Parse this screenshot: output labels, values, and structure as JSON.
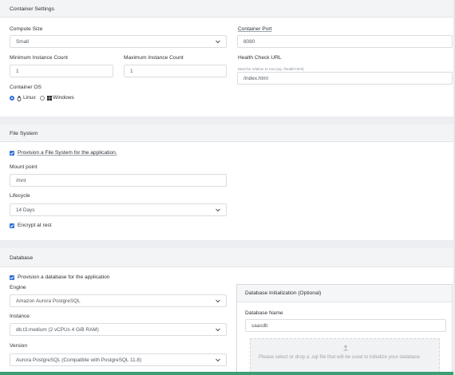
{
  "container": {
    "header": "Container Settings",
    "compute_size": {
      "label": "Compute Size",
      "value": "Small"
    },
    "container_port": {
      "label": "Container Port",
      "value": "8080"
    },
    "min_count": {
      "label": "Minimum Instance Count",
      "value": "1"
    },
    "max_count": {
      "label": "Maximum Instance Count",
      "value": "1"
    },
    "health_check": {
      "label": "Health Check URL",
      "hint": "Must be relative to root (eg. /health.html)",
      "value": "/index.html"
    },
    "os": {
      "label": "Container OS",
      "linux": "Linux",
      "windows": "Windows",
      "selected": "Linux"
    }
  },
  "filesystem": {
    "header": "File System",
    "provision_label": "Provision a File System for the application.",
    "provision_checked": true,
    "mount_point": {
      "label": "Mount point",
      "value": "/mnt"
    },
    "lifecycle": {
      "label": "Lifecycle",
      "value": "14 Days"
    },
    "encrypt_label": "Encrypt at rest",
    "encrypt_checked": true
  },
  "database": {
    "header": "Database",
    "provision_label": "Provision a database for the application",
    "provision_checked": true,
    "engine": {
      "label": "Engine",
      "value": "Amazon Aurora PostgreSQL"
    },
    "instance": {
      "label": "Instance",
      "value": "db.t3.medium (2 vCPUs 4 GiB RAM)"
    },
    "version": {
      "label": "Version",
      "value": "Aurora PostgreSQL (Compatible with PostgreSQL 11.8)"
    },
    "init_panel": {
      "title": "Database Initialization (Optional)",
      "name_label": "Database Name",
      "name_value": "saasdb",
      "dropzone_text": "Please select or drop a .sql file that will be used to initialize your database"
    }
  },
  "icons": {
    "chevron": "chevron-down-icon",
    "linux": "linux-icon",
    "windows": "windows-icon",
    "upload": "upload-icon"
  },
  "colors": {
    "accent": "#2f6fd6",
    "section_bg": "#f3f4f6",
    "bottom_bar": "#3c9e74"
  }
}
